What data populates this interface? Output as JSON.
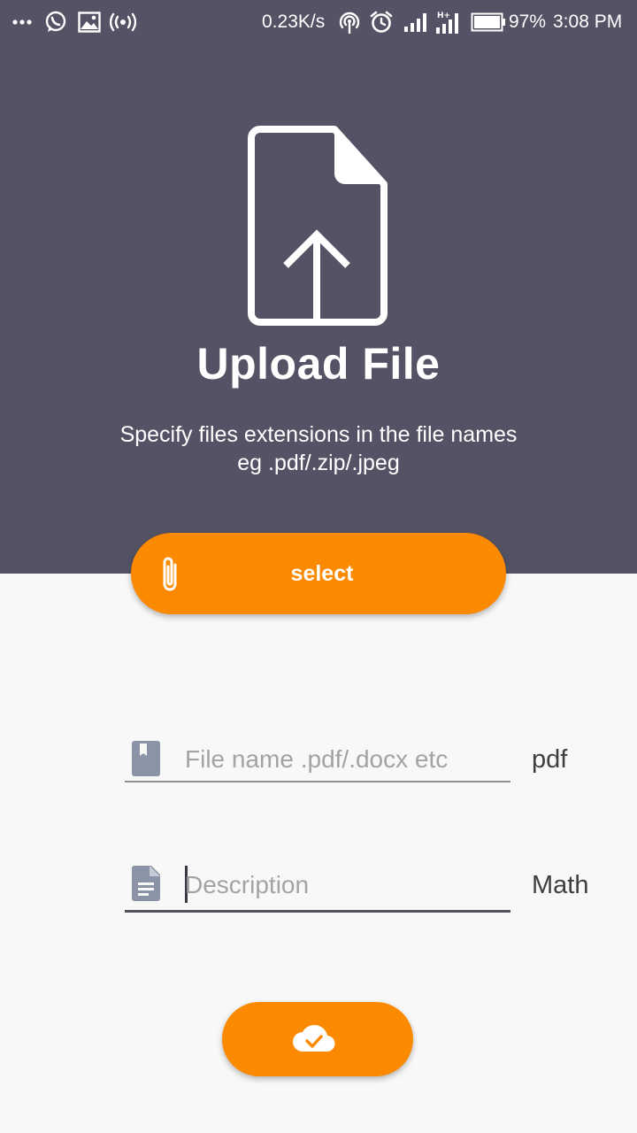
{
  "status_bar": {
    "network_speed": "0.23K/s",
    "battery": "97%",
    "time": "3:08 PM",
    "icons": [
      "more-icon",
      "whatsapp-icon",
      "gallery-icon",
      "hotspot-icon",
      "nfc-icon",
      "alarm-icon",
      "signal-icon",
      "signal-h-icon",
      "battery-icon"
    ]
  },
  "header": {
    "icon": "file-upload-icon",
    "title": "Upload File",
    "subtitle_line1": "Specify files extensions in the file names",
    "subtitle_line2": "eg .pdf/.zip/.jpeg"
  },
  "select_button": {
    "icon": "paperclip-icon",
    "label": "select"
  },
  "form": {
    "file_name": {
      "icon": "bookmark-icon",
      "value": "",
      "placeholder": "File name .pdf/.docx etc",
      "tag": "pdf"
    },
    "description": {
      "icon": "document-icon",
      "value": "",
      "placeholder": "Description",
      "tag": "Math"
    }
  },
  "upload_button": {
    "icon": "cloud-check-icon"
  },
  "colors": {
    "header_bg": "#545365",
    "accent": "#fb8a00",
    "page_bg": "#f8f8f8",
    "placeholder_text": "#a3a3a3",
    "icon_grey": "#8b93a6"
  }
}
